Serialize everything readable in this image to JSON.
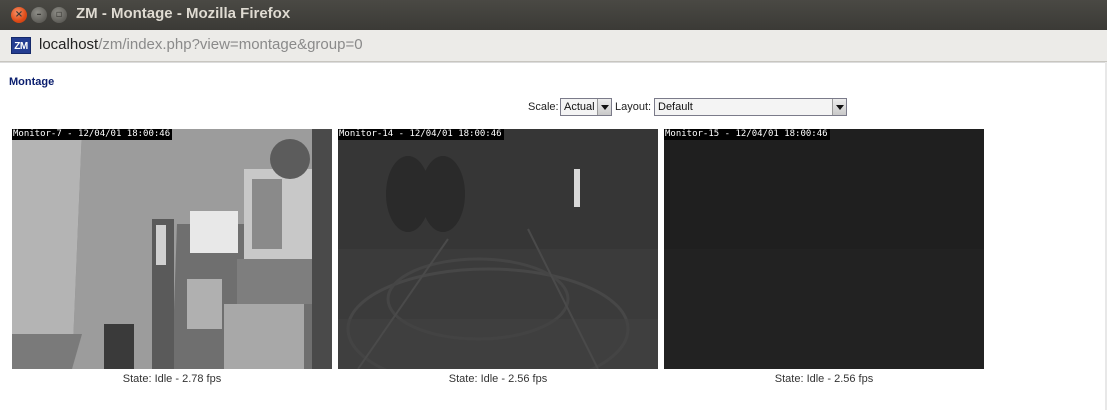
{
  "window": {
    "title": "ZM - Montage - Mozilla Firefox"
  },
  "urlbar": {
    "host": "localhost",
    "path": "/zm/index.php?view=montage&group=0",
    "favicon_text": "ZM"
  },
  "page": {
    "heading": "Montage",
    "scale_label": "Scale:",
    "scale_value": "Actual",
    "layout_label": "Layout:",
    "layout_value": "Default"
  },
  "monitors": [
    {
      "overlay": "Monitor-7 - 12/04/01 18:00:46",
      "status": "State: Idle - 2.78 fps"
    },
    {
      "overlay": "Monitor-14 - 12/04/01 18:00:46",
      "status": "State: Idle - 2.56 fps"
    },
    {
      "overlay": "Monitor-15 - 12/04/01 18:00:46",
      "status": "State: Idle - 2.56 fps"
    }
  ],
  "colors": {
    "titlebar": "#3c3b37",
    "heading": "#0a1e6e",
    "feed_dark": "#1f1f1f"
  }
}
